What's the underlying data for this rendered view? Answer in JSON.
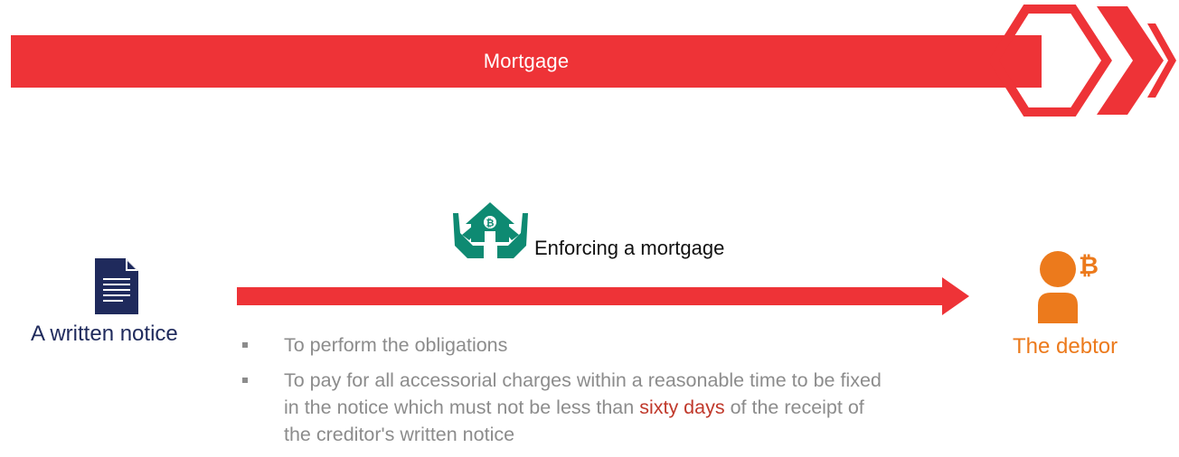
{
  "banner": {
    "title": "Mortgage",
    "color": "#ee3337"
  },
  "logo": {
    "icon": "chevron-hexagon-logo-icon",
    "color": "#ee3337"
  },
  "notice": {
    "icon": "document-icon",
    "label": "A written notice",
    "color": "#1f2a5c"
  },
  "enforcement": {
    "icon": "house-in-hands-bitcoin-icon",
    "label": "Enforcing a mortgage",
    "icon_color": "#0e8a72",
    "arrow_color": "#ee3337"
  },
  "debtor": {
    "icon": "person-bitcoin-icon",
    "label": "The debtor",
    "color": "#ec7a1c"
  },
  "obligations": [
    {
      "text": "To perform the obligations"
    },
    {
      "text_before": "To pay for all accessorial charges within a reasonable time to be fixed in the notice which must not be less than ",
      "highlight": "sixty days",
      "text_after": " of the receipt of the creditor's written notice"
    }
  ]
}
